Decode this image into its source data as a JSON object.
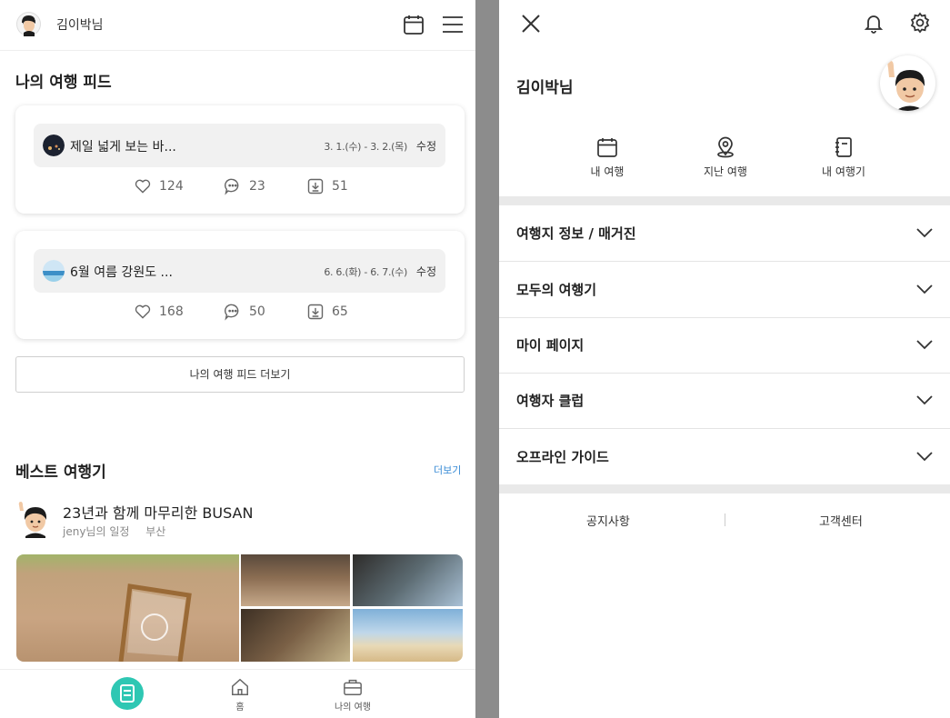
{
  "header": {
    "username": "김이박님"
  },
  "my_feed": {
    "title": "나의 여행 피드",
    "cards": [
      {
        "name": "제일 넓게 보는 바...",
        "dates": "3. 1.(수) - 3. 2.(목)",
        "edit_label": "수정",
        "likes": "124",
        "comments": "23",
        "downloads": "51"
      },
      {
        "name": "6월 여름 강원도 ...",
        "dates": "6. 6.(화) - 6. 7.(수)",
        "edit_label": "수정",
        "likes": "168",
        "comments": "50",
        "downloads": "65"
      }
    ],
    "more_label": "나의 여행 피드 더보기"
  },
  "best": {
    "title": "베스트 여행기",
    "more_link": "더보기",
    "post": {
      "title": "23년과 함께 마무리한 BUSAN",
      "author": "jeny님의 일정",
      "location": "부산"
    }
  },
  "bottom_nav": {
    "home_label": "홈",
    "my_trip_label": "나의 여행"
  },
  "drawer": {
    "username": "김이박님",
    "quick_links": [
      "내 여행",
      "지난 여행",
      "내 여행기"
    ],
    "menu": [
      "여행지 정보 / 매거진",
      "모두의 여행기",
      "마이 페이지",
      "여행자 클럽",
      "오프라인 가이드"
    ],
    "footer": {
      "notice": "공지사항",
      "support": "고객센터"
    }
  },
  "colors": {
    "accent": "#2ec7b3",
    "link": "#3a8cd6",
    "overlay": "#8c8c8c"
  }
}
